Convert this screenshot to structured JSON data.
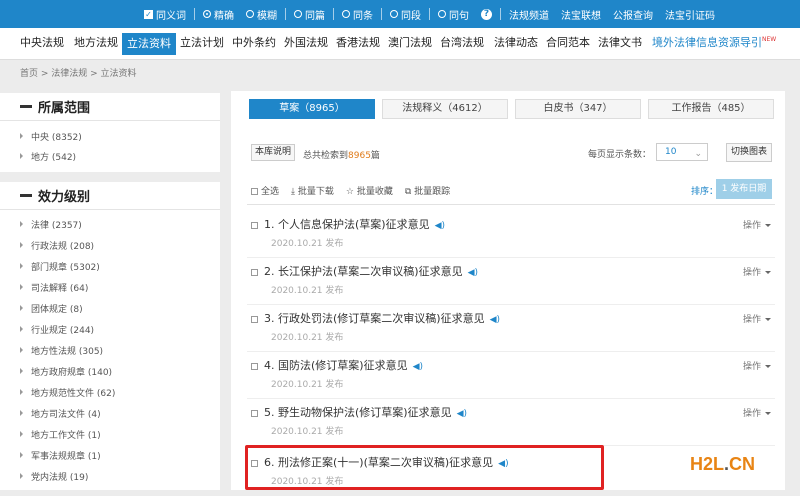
{
  "topbar": {
    "full_text_label": "同义词",
    "fuzzy_match": "精确",
    "exact_match": "模糊",
    "options": [
      "同篇",
      "同条",
      "同段",
      "同句"
    ],
    "help": "?",
    "links": [
      "法规频道",
      "法宝联想",
      "公报查询",
      "法宝引证码"
    ]
  },
  "nav": {
    "items": [
      "中央法规",
      "地方法规",
      "立法资料",
      "立法计划",
      "中外条约",
      "外国法规",
      "香港法规",
      "澳门法规",
      "台湾法规",
      "法律动态",
      "合同范本",
      "法律文书"
    ],
    "active_index": 2,
    "external": "境外法律信息资源导引",
    "new_badge": "NEW"
  },
  "breadcrumb": "首页 > 法律法规 > 立法资料",
  "sidebar": {
    "scope": {
      "title": "所属范围",
      "items": [
        "中央 (8352)",
        "地方 (542)"
      ]
    },
    "level": {
      "title": "效力级别",
      "items": [
        "法律 (2357)",
        "行政法规 (208)",
        "部门规章 (5302)",
        "司法解释 (64)",
        "团体规定 (8)",
        "行业规定 (244)",
        "地方性法规 (305)",
        "地方政府规章 (140)",
        "地方规范性文件 (62)",
        "地方司法文件 (4)",
        "地方工作文件 (1)",
        "军事法规规章 (1)",
        "党内法规 (19)"
      ]
    }
  },
  "tabs": [
    {
      "label": "草案（8965）"
    },
    {
      "label": "法规释义（4612）"
    },
    {
      "label": "白皮书（347）"
    },
    {
      "label": "工作报告（485）"
    }
  ],
  "info": {
    "desc_button": "本库说明",
    "total_prefix": "总共检索到",
    "total_count": "8965",
    "total_suffix": "篇",
    "per_page_label": "每页显示条数：",
    "per_page_value": "10",
    "switch_button": "切换图表"
  },
  "toolbar": {
    "select_all": "全选",
    "batch_download": "批量下载",
    "batch_favorite": "批量收藏",
    "batch_track": "批量跟踪",
    "sort_label": "排序：",
    "sort_value": "1 发布日期"
  },
  "list": [
    {
      "title": "1. 个人信息保护法(草案)征求意见",
      "date": "2020.10.21 发布",
      "op": "操作"
    },
    {
      "title": "2. 长江保护法(草案二次审议稿)征求意见",
      "date": "2020.10.21 发布",
      "op": "操作"
    },
    {
      "title": "3. 行政处罚法(修订草案二次审议稿)征求意见",
      "date": "2020.10.21 发布",
      "op": "操作"
    },
    {
      "title": "4. 国防法(修订草案)征求意见",
      "date": "2020.10.21 发布",
      "op": "操作"
    },
    {
      "title": "5. 野生动物保护法(修订草案)征求意见",
      "date": "2020.10.21 发布",
      "op": "操作"
    },
    {
      "title": "6. 刑法修正案(十一)(草案二次审议稿)征求意见",
      "date": "2020.10.21 发布",
      "op": ""
    }
  ],
  "watermark": {
    "a": "H2L",
    "b": ".",
    "c": "CN"
  },
  "colors": {
    "brand": "#1f86c9",
    "highlight": "#e02222",
    "watermark": "#e88414"
  }
}
